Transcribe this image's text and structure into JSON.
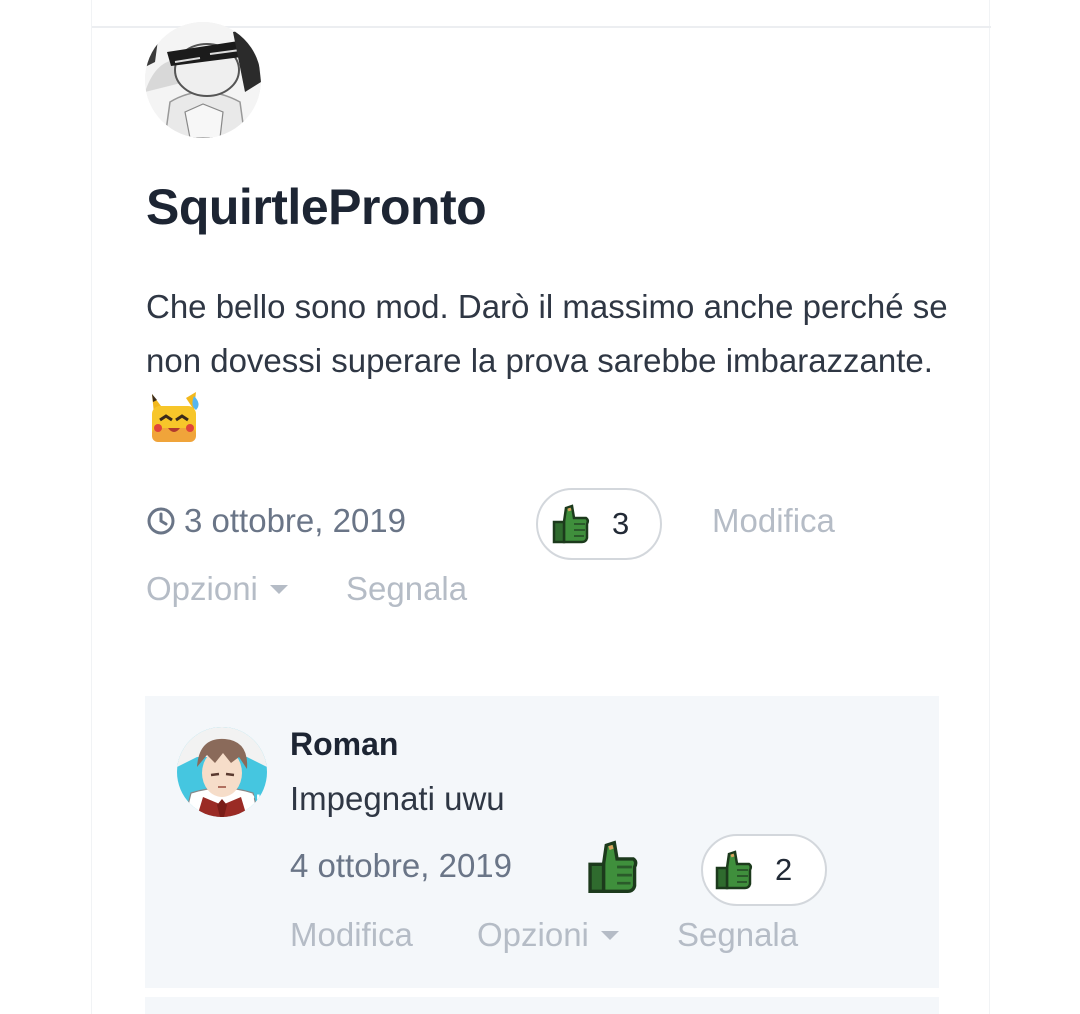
{
  "post": {
    "author": "SquirtlePronto",
    "text": "Che bello sono mod. Darò il massimo anche perché se non dovessi superare la prova sarebbe imbarazzante.",
    "date": "3 ottobre, 2019",
    "likes": "3",
    "actions": {
      "edit": "Modifica",
      "options": "Opzioni",
      "report": "Segnala"
    }
  },
  "reply": {
    "author": "Roman",
    "text": "Impegnati uwu",
    "date": "4 ottobre, 2019",
    "likes": "2",
    "actions": {
      "edit": "Modifica",
      "options": "Opzioni",
      "report": "Segnala"
    }
  },
  "icons": {
    "clock": "clock-icon",
    "like": "thumbs-up-icon",
    "options": "chevron-down-icon",
    "emoji": "pikachu-sweat-emoji"
  },
  "colors": {
    "text_dark": "#1d2533",
    "text_body": "#2f3744",
    "meta": "#6a7587",
    "action": "#b5bcc6",
    "reply_bg": "#f4f7fa",
    "thumb_green": "#3f8f3c"
  }
}
